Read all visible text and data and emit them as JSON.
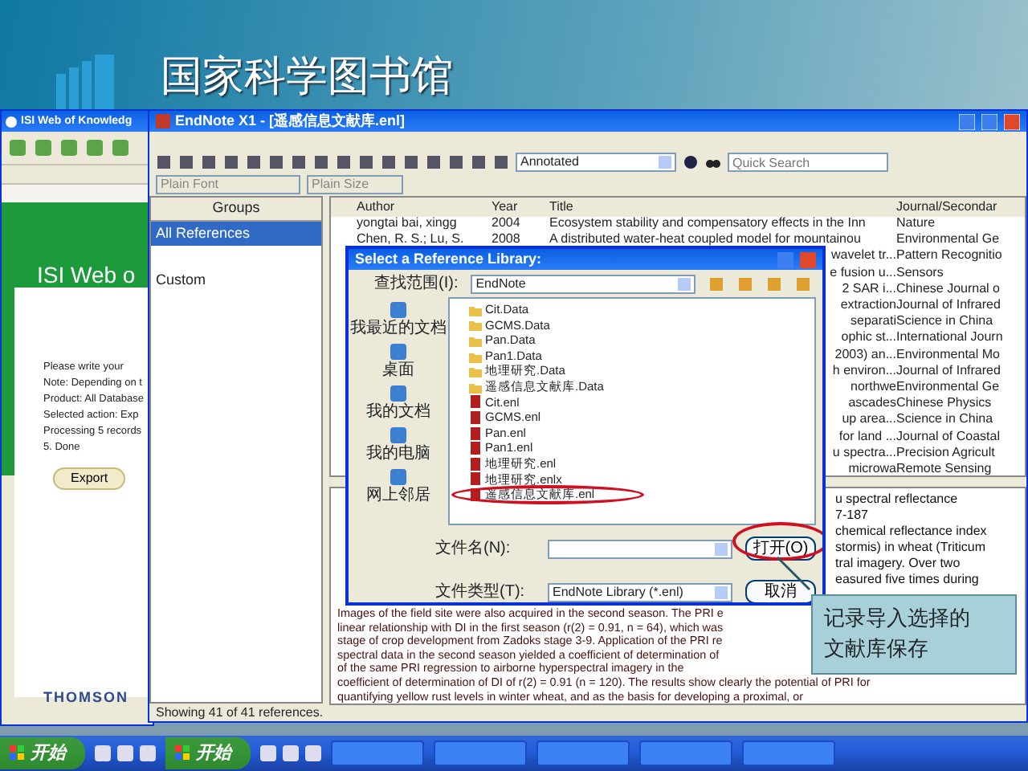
{
  "slide": {
    "title": "国家科学图书馆"
  },
  "isi_window": {
    "title": "ISI Web of Knowledg",
    "heading": "ISI Web o",
    "lines": [
      "Please write your",
      "Note: Depending on t",
      "Product: All Database",
      "Selected action: Exp",
      "Processing 5 records",
      "5. Done"
    ],
    "export_button": "Export",
    "logo": "THOMSON"
  },
  "endnote": {
    "title": "EndNote X1 - [遥感信息文献库.enl]",
    "style": "Annotated",
    "search_placeholder": "Quick Search",
    "font": "Plain Font",
    "size": "Plain Size",
    "groups_header": "Groups",
    "groups": [
      {
        "label": "All References",
        "selected": true
      },
      {
        "label": "Custom",
        "selected": false
      }
    ],
    "columns": [
      "Author",
      "Year",
      "Title",
      "Journal/Secondar"
    ],
    "rows": [
      {
        "author": "yongtai bai, xingg",
        "year": "2004",
        "title": "Ecosystem stability and compensatory effects in the Inn",
        "journal": "Nature"
      },
      {
        "author": "Chen, R. S.; Lu, S.",
        "year": "2008",
        "title": "A distributed water-heat coupled model for mountainou",
        "journal": "Environmental Ge"
      },
      {
        "title": "wavelet tr...",
        "journal": "Pattern Recognitio"
      },
      {
        "title": "e fusion u...",
        "journal": "Sensors"
      },
      {
        "title": "2 SAR i...",
        "journal": "Chinese Journal o"
      },
      {
        "title": "extraction",
        "journal": "Journal of Infrared"
      },
      {
        "title": "separati",
        "journal": "Science in China"
      },
      {
        "title": "ophic st...",
        "journal": "International Journ"
      },
      {
        "title": "2003) an...",
        "journal": "Environmental Mo"
      },
      {
        "title": "h environ...",
        "journal": "Journal of Infrared"
      },
      {
        "title": "northwe",
        "journal": "Environmental Ge"
      },
      {
        "title": "ascades",
        "journal": "Chinese Physics"
      },
      {
        "title": "up area...",
        "journal": "Science in China"
      },
      {
        "title": "for land ...",
        "journal": "Journal of Coastal"
      },
      {
        "title": "u spectra...",
        "journal": "Precision Agricult"
      },
      {
        "title": "microwa",
        "journal": "Remote Sensing"
      }
    ],
    "preview_side": [
      "u spectral reflectance",
      "7-187",
      "chemical reflectance index",
      "stormis) in wheat (Triticum",
      "tral imagery. Over two",
      "easured five times during"
    ],
    "preview_lines": [
      "Images of the field site were also acquired in the second season. The PRI e",
      "linear relationship with DI in the first season (r(2) = 0.91, n = 64), which was",
      "stage of crop development from Zadoks stage 3-9. Application of the PRI re",
      "spectral data in the second season yielded a coefficient of determination of",
      "of the same PRI regression to airborne hyperspectral imagery in the",
      "coefficient of determination of DI of r(2) = 0.91 (n = 120). The results show clearly the potential of PRI for",
      "quantifying yellow rust levels in winter wheat, and as the basis for developing a proximal, or"
    ],
    "status": "Showing 41 of 41 references."
  },
  "dialog": {
    "title": "Select a Reference Library:",
    "look_in_label": "查找范围(I):",
    "look_in": "EndNote",
    "places": [
      "我最近的文档",
      "桌面",
      "我的文档",
      "我的电脑",
      "网上邻居"
    ],
    "files": [
      {
        "name": "Cit.Data",
        "kind": "folder",
        "circled": false
      },
      {
        "name": "GCMS.Data",
        "kind": "folder",
        "circled": false
      },
      {
        "name": "Pan.Data",
        "kind": "folder",
        "circled": false
      },
      {
        "name": "Pan1.Data",
        "kind": "folder",
        "circled": false
      },
      {
        "name": "地理研究.Data",
        "kind": "folder",
        "circled": false
      },
      {
        "name": "遥感信息文献库.Data",
        "kind": "folder",
        "circled": false
      },
      {
        "name": "Cit.enl",
        "kind": "library",
        "circled": false
      },
      {
        "name": "GCMS.enl",
        "kind": "library",
        "circled": false
      },
      {
        "name": "Pan.enl",
        "kind": "library",
        "circled": false
      },
      {
        "name": "Pan1.enl",
        "kind": "library",
        "circled": false
      },
      {
        "name": "地理研究.enl",
        "kind": "library",
        "circled": false
      },
      {
        "name": "地理研究.enlx",
        "kind": "library",
        "circled": false
      },
      {
        "name": "遥感信息文献库.enl",
        "kind": "library",
        "circled": true
      }
    ],
    "file_name_label": "文件名(N):",
    "file_type_label": "文件类型(T):",
    "file_type": "EndNote Library (*.enl)",
    "open_button": "打开(O)",
    "open_circled": true,
    "cancel_button": "取消"
  },
  "callout": {
    "lines": [
      "记录导入选择的",
      "文献库保存"
    ]
  },
  "taskbar": {
    "start_buttons": [
      "开始",
      "开始"
    ]
  }
}
